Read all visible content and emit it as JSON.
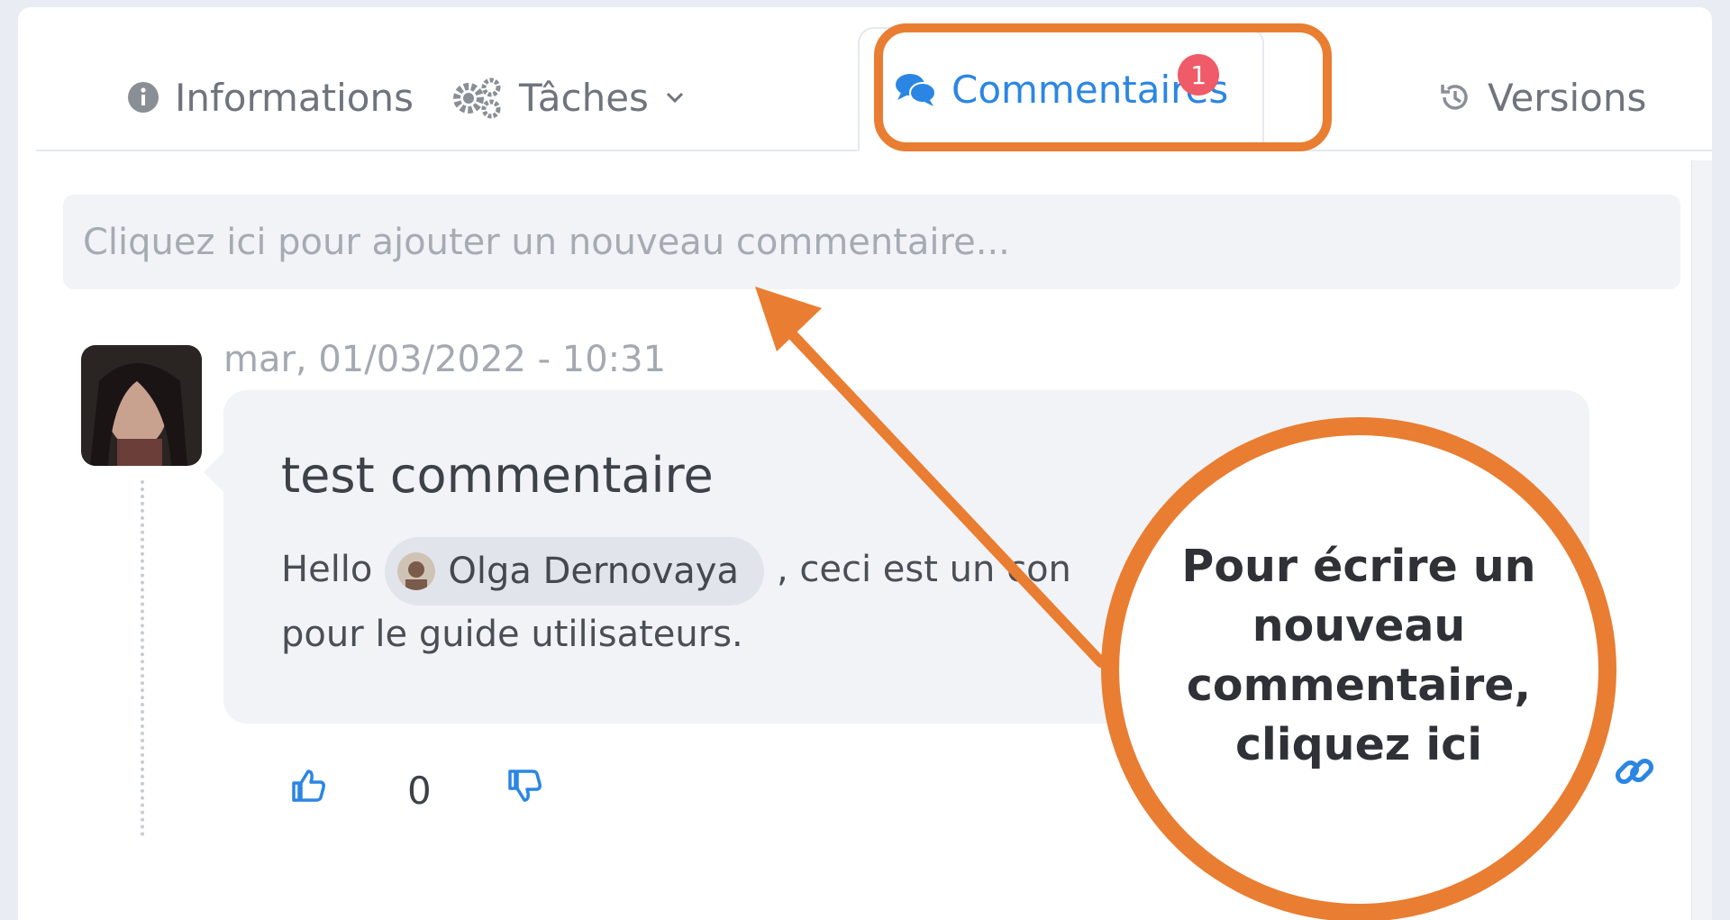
{
  "tabs": [
    {
      "label": "Informations",
      "icon": "info-circle-icon"
    },
    {
      "label": "Tâches",
      "icon": "gears-icon",
      "dropdown_icon": "chevron-down-icon"
    },
    {
      "label": "Commentaires",
      "icon": "comments-icon",
      "badge": "1",
      "active": true
    },
    {
      "label": "Versions",
      "icon": "history-icon"
    }
  ],
  "new_comment": {
    "placeholder": "Cliquez ici pour ajouter un nouveau commentaire..."
  },
  "comment": {
    "timestamp": "mar, 01/03/2022 - 10:31",
    "title": "test commentaire",
    "body_before": "Hello",
    "mention": "Olga Dernovaya",
    "body_after_line1": ", ceci est un con",
    "body_line2": "pour le guide utilisateurs.",
    "likes": "0"
  },
  "annotation": {
    "callout": "Pour écrire un nouveau commentaire, cliquez ici",
    "color": "#e97d31"
  },
  "colors": {
    "accent": "#2b86e3",
    "badge": "#ef5b68"
  }
}
